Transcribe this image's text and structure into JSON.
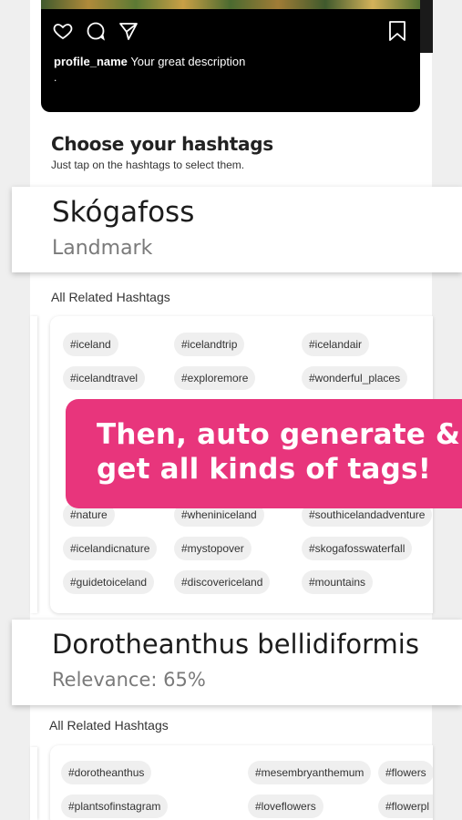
{
  "post": {
    "profile_name": "profile_name",
    "description": "Your great description",
    "dot": "."
  },
  "choose": {
    "title": "Choose your hashtags",
    "subtitle": "Just tap on the hashtags to select them."
  },
  "entities": [
    {
      "name": "Skógafoss",
      "sub": "Landmark"
    },
    {
      "name": "Dorotheanthus bellidiformis",
      "sub": "Relevance: 65%"
    }
  ],
  "related_label": "All Related Hashtags",
  "tags_group1": [
    "#iceland",
    "#icelandtrip",
    "#icelandair",
    "#icelandtravel",
    "#exploremore",
    "#wonderful_places",
    "#nature",
    "#wheniniceland",
    "#southicelandadventure",
    "#icelandicnature",
    "#mystopover",
    "#skogafosswaterfall",
    "#guidetoiceland",
    "#discovericeland",
    "#mountains"
  ],
  "tags_group2": [
    "#dorotheanthus",
    "#mesembryanthemum",
    "#flowers",
    "#plantsofinstagram",
    "#loveflowers",
    "#flowerpl"
  ],
  "promo": {
    "line1": "Then, auto generate &",
    "line2": "get all kinds of tags!"
  },
  "colors": {
    "accent": "#e8357c",
    "tag_bg": "#efefef"
  },
  "icons": [
    "heart-icon",
    "comment-icon",
    "share-icon",
    "bookmark-icon"
  ]
}
